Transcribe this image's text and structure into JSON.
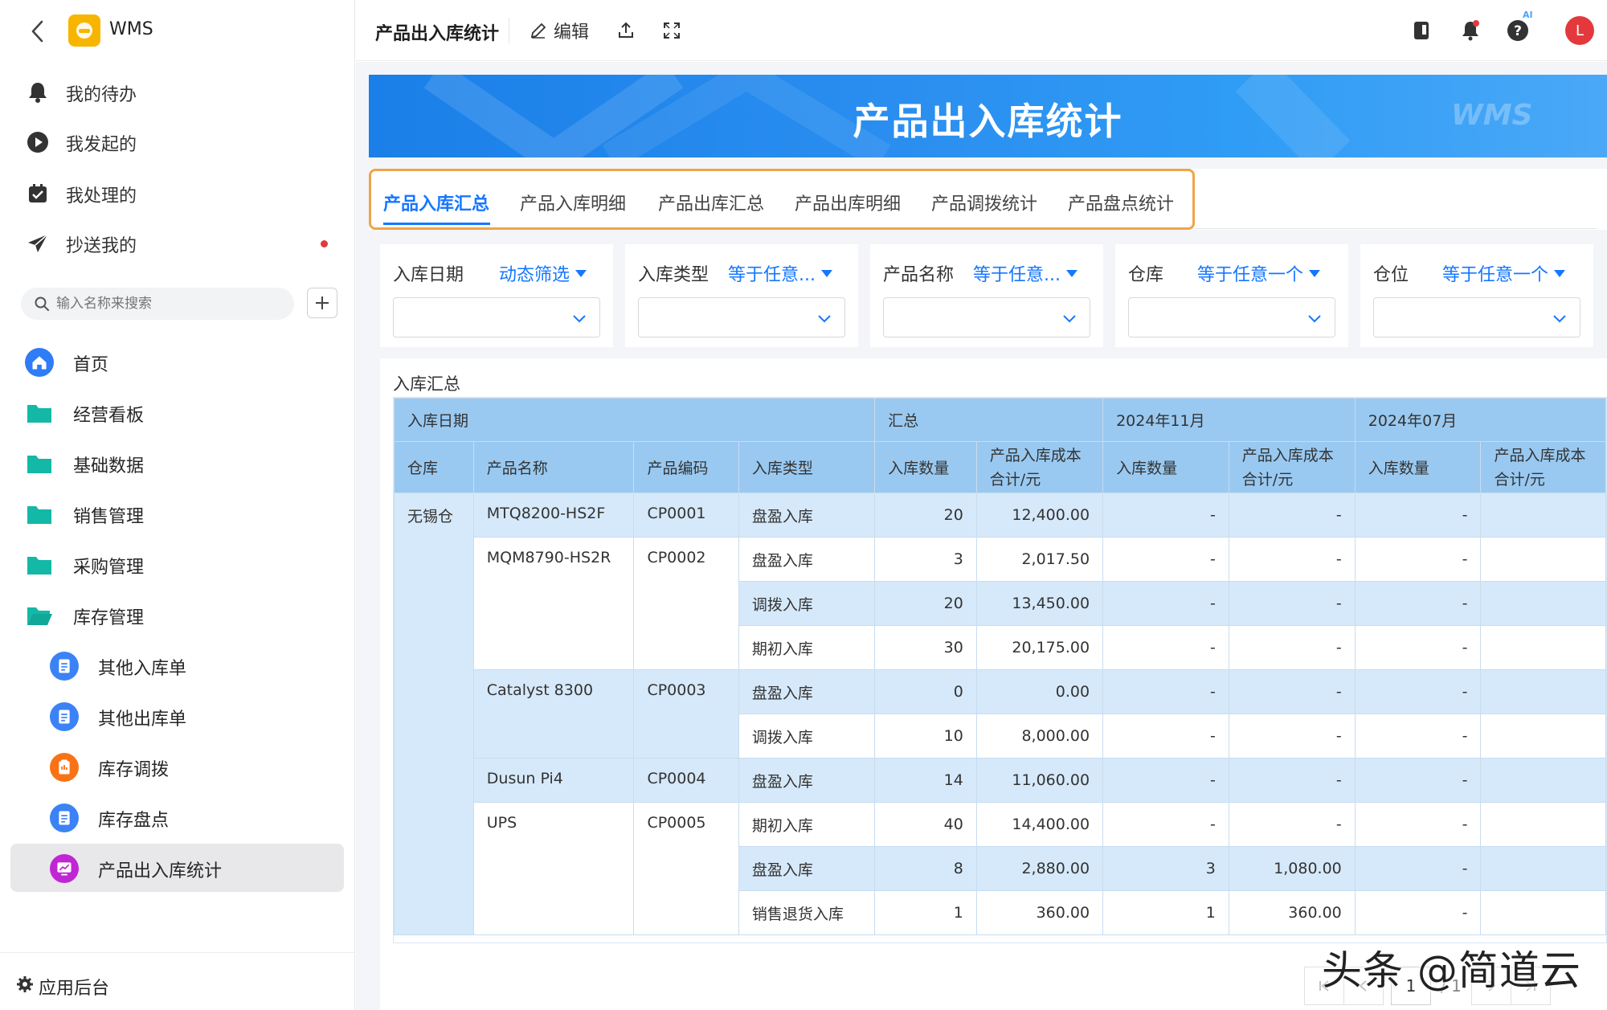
{
  "app": {
    "name": "WMS",
    "page_title": "产品出入库统计"
  },
  "sidebar": {
    "quick": [
      {
        "label": "我的待办",
        "icon": "bell-icon"
      },
      {
        "label": "我发起的",
        "icon": "play-circle-icon"
      },
      {
        "label": "我处理的",
        "icon": "checkbox-icon"
      },
      {
        "label": "抄送我的",
        "icon": "send-icon"
      }
    ],
    "search_placeholder": "输入名称来搜索",
    "nav": [
      {
        "label": "首页",
        "icon": "home-icon"
      },
      {
        "label": "经营看板",
        "icon": "folder-icon"
      },
      {
        "label": "基础数据",
        "icon": "folder-icon"
      },
      {
        "label": "销售管理",
        "icon": "folder-icon"
      },
      {
        "label": "采购管理",
        "icon": "folder-icon"
      },
      {
        "label": "库存管理",
        "icon": "folder-open-icon"
      }
    ],
    "sub_nav": [
      {
        "label": "其他入库单",
        "icon": "document-icon",
        "color": "#3b82f6"
      },
      {
        "label": "其他出库单",
        "icon": "document-icon",
        "color": "#3b82f6"
      },
      {
        "label": "库存调拨",
        "icon": "clipboard-icon",
        "color": "#f97316"
      },
      {
        "label": "库存盘点",
        "icon": "document-icon",
        "color": "#3b82f6"
      },
      {
        "label": "产品出入库统计",
        "icon": "chart-icon",
        "color": "#c026d3"
      }
    ],
    "footer": "应用后台"
  },
  "topbar": {
    "title": "产品出入库统计",
    "edit": "编辑",
    "avatar": "L",
    "ai": "AI"
  },
  "banner": {
    "title": "产品出入库统计",
    "watermark": "WMS"
  },
  "tabs": [
    "产品入库汇总",
    "产品入库明细",
    "产品出库汇总",
    "产品出库明细",
    "产品调拨统计",
    "产品盘点统计"
  ],
  "filters": [
    {
      "label": "入库日期",
      "mode": "动态筛选"
    },
    {
      "label": "入库类型",
      "mode": "等于任意..."
    },
    {
      "label": "产品名称",
      "mode": "等于任意..."
    },
    {
      "label": "仓库",
      "mode": "等于任意一个"
    },
    {
      "label": "仓位",
      "mode": "等于任意一个"
    }
  ],
  "panel_title": "入库汇总",
  "table": {
    "header_top": {
      "date": "入库日期",
      "total": "汇总",
      "m1": "2024年11月",
      "m2": "2024年07月"
    },
    "header_cols": {
      "warehouse": "仓库",
      "product": "产品名称",
      "code": "产品编码",
      "type": "入库类型",
      "qty": "入库数量",
      "cost_l1": "产品入库成本",
      "cost_l2": "合计/元"
    },
    "warehouse": "无锡仓",
    "rows": [
      {
        "product": "MTQ8200-HS2F",
        "code": "CP0001",
        "type": "盘盈入库",
        "qty": "20",
        "cost": "12,400.00",
        "m1q": "-",
        "m1c": "-",
        "m2q": "-"
      },
      {
        "product": "MQM8790-HS2R",
        "code": "CP0002",
        "type": "盘盈入库",
        "qty": "3",
        "cost": "2,017.50",
        "m1q": "-",
        "m1c": "-",
        "m2q": "-"
      },
      {
        "product": "",
        "code": "",
        "type": "调拨入库",
        "qty": "20",
        "cost": "13,450.00",
        "m1q": "-",
        "m1c": "-",
        "m2q": "-"
      },
      {
        "product": "",
        "code": "",
        "type": "期初入库",
        "qty": "30",
        "cost": "20,175.00",
        "m1q": "-",
        "m1c": "-",
        "m2q": "-"
      },
      {
        "product": "Catalyst 8300",
        "code": "CP0003",
        "type": "盘盈入库",
        "qty": "0",
        "cost": "0.00",
        "m1q": "-",
        "m1c": "-",
        "m2q": "-"
      },
      {
        "product": "",
        "code": "",
        "type": "调拨入库",
        "qty": "10",
        "cost": "8,000.00",
        "m1q": "-",
        "m1c": "-",
        "m2q": "-"
      },
      {
        "product": "Dusun Pi4",
        "code": "CP0004",
        "type": "盘盈入库",
        "qty": "14",
        "cost": "11,060.00",
        "m1q": "-",
        "m1c": "-",
        "m2q": "-"
      },
      {
        "product": "UPS",
        "code": "CP0005",
        "type": "期初入库",
        "qty": "40",
        "cost": "14,400.00",
        "m1q": "-",
        "m1c": "-",
        "m2q": "-"
      },
      {
        "product": "",
        "code": "",
        "type": "盘盈入库",
        "qty": "8",
        "cost": "2,880.00",
        "m1q": "3",
        "m1c": "1,080.00",
        "m2q": "-"
      },
      {
        "product": "",
        "code": "",
        "type": "销售退货入库",
        "qty": "1",
        "cost": "360.00",
        "m1q": "1",
        "m1c": "360.00",
        "m2q": "-"
      }
    ]
  },
  "pager": {
    "current": "1",
    "total": "/ 1"
  },
  "watermark": "头条 @简道云"
}
